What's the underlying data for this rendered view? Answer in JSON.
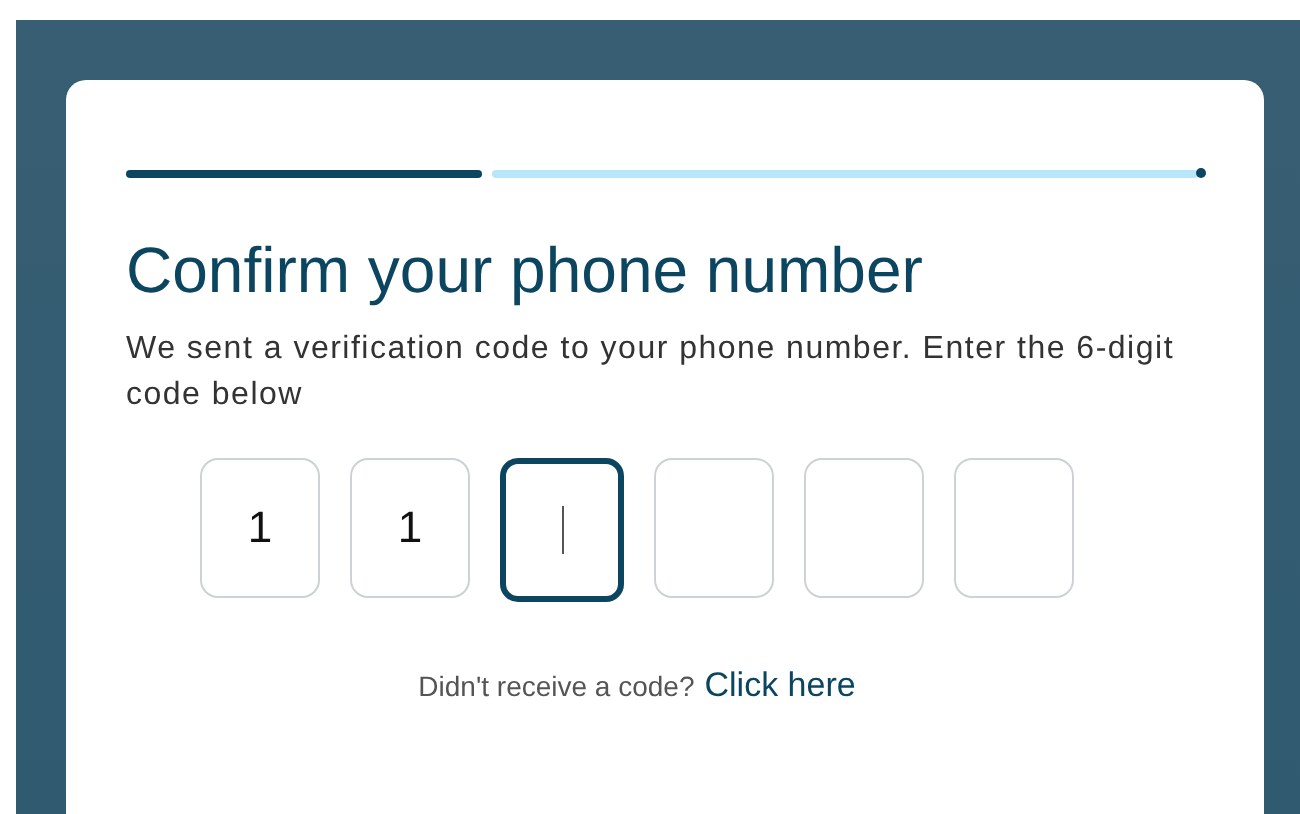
{
  "progress": {
    "steps": [
      {
        "completed": true
      },
      {
        "completed": false
      }
    ]
  },
  "title": "Confirm your phone number",
  "description": "We sent a verification code to your phone number. Enter the 6-digit code below",
  "code_inputs": [
    {
      "value": "1",
      "focused": false
    },
    {
      "value": "1",
      "focused": false
    },
    {
      "focused": true
    },
    {
      "focused": false
    },
    {
      "focused": false
    },
    {
      "focused": false
    }
  ],
  "resend": {
    "prompt": "Didn't receive a code?",
    "link": "Click here"
  }
}
